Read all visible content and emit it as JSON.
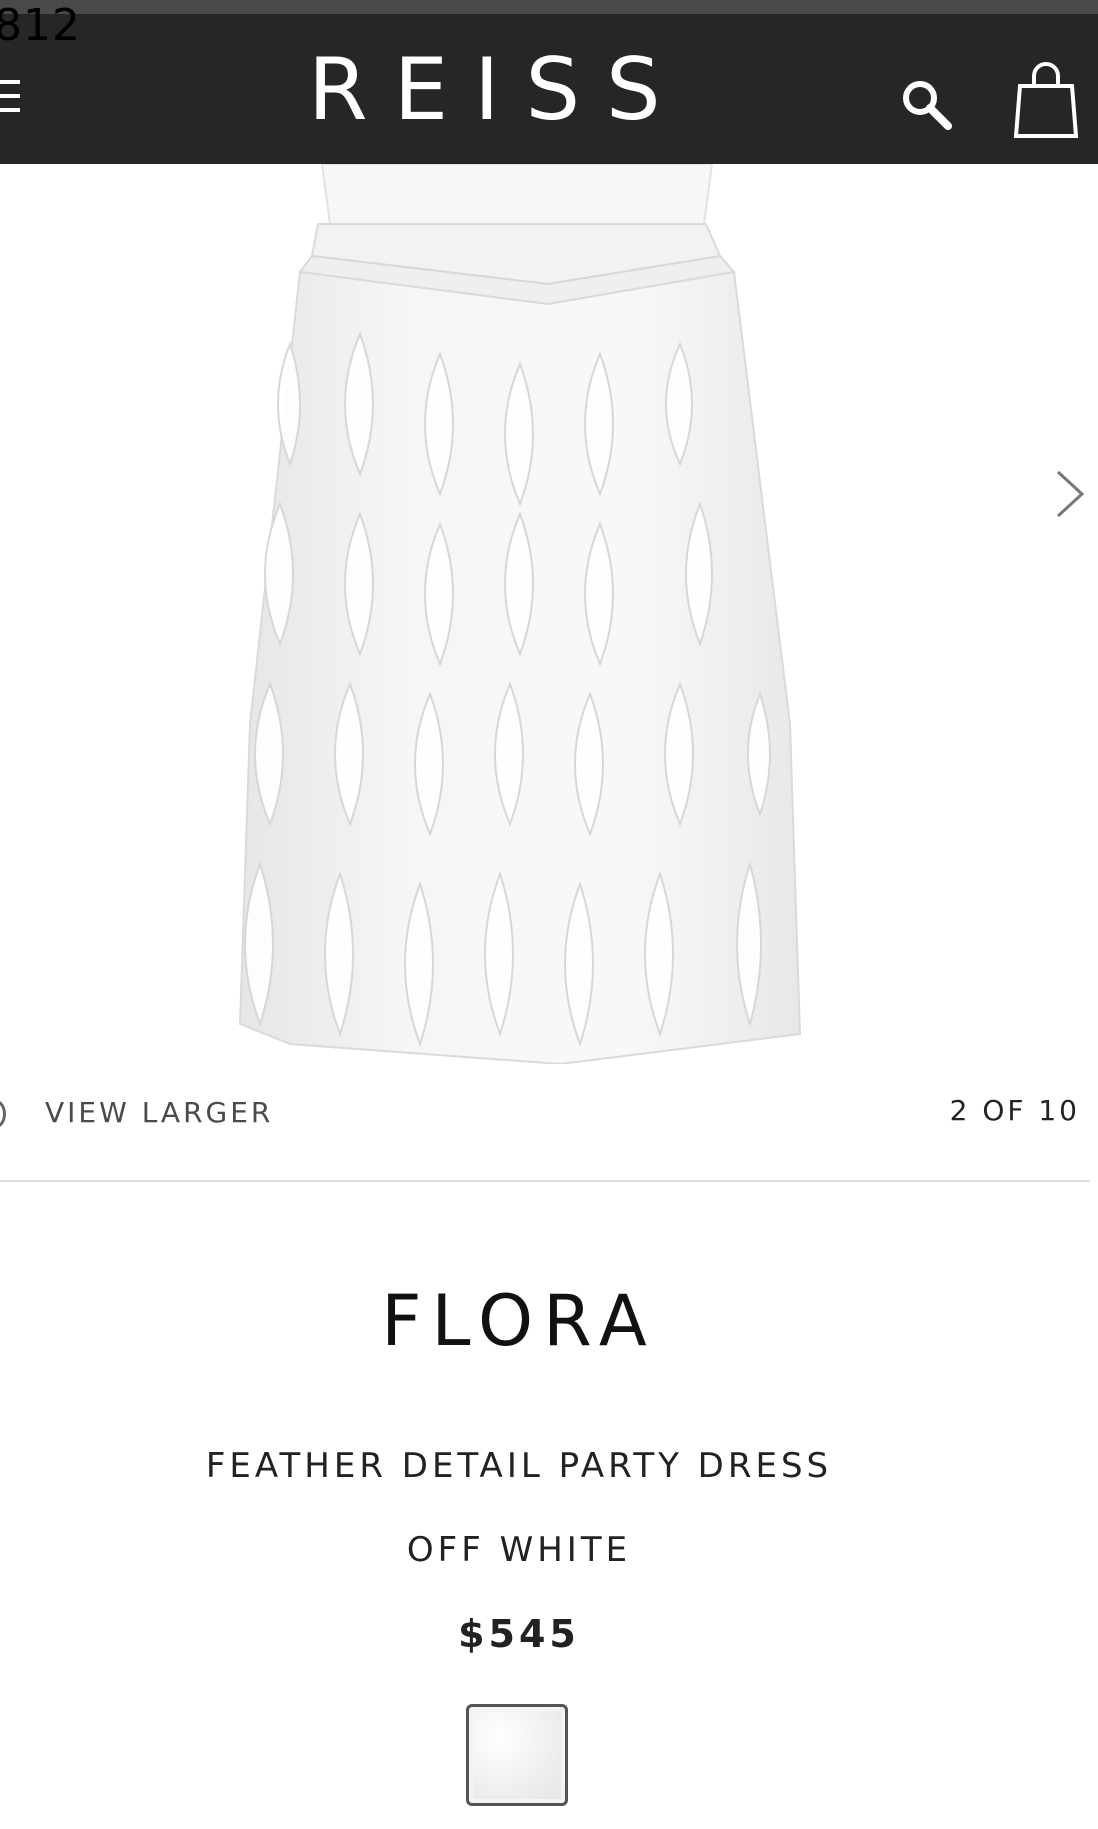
{
  "status_bar": {
    "time": "812"
  },
  "header": {
    "logo": "REISS",
    "menu_icon": "hamburger-menu-icon",
    "search_icon": "search-icon",
    "bag_icon": "shopping-bag-icon",
    "background": "#262626"
  },
  "gallery": {
    "view_larger": "VIEW LARGER",
    "pager": "2 OF 10",
    "next_icon": "chevron-right-icon"
  },
  "product": {
    "brand": "FLORA",
    "title": "FEATHER DETAIL PARTY DRESS",
    "colour": "OFF WHITE",
    "price": "$545"
  },
  "swatches": [
    {
      "colour_name": "OFF WHITE",
      "hex": "#f4f4f4"
    }
  ]
}
